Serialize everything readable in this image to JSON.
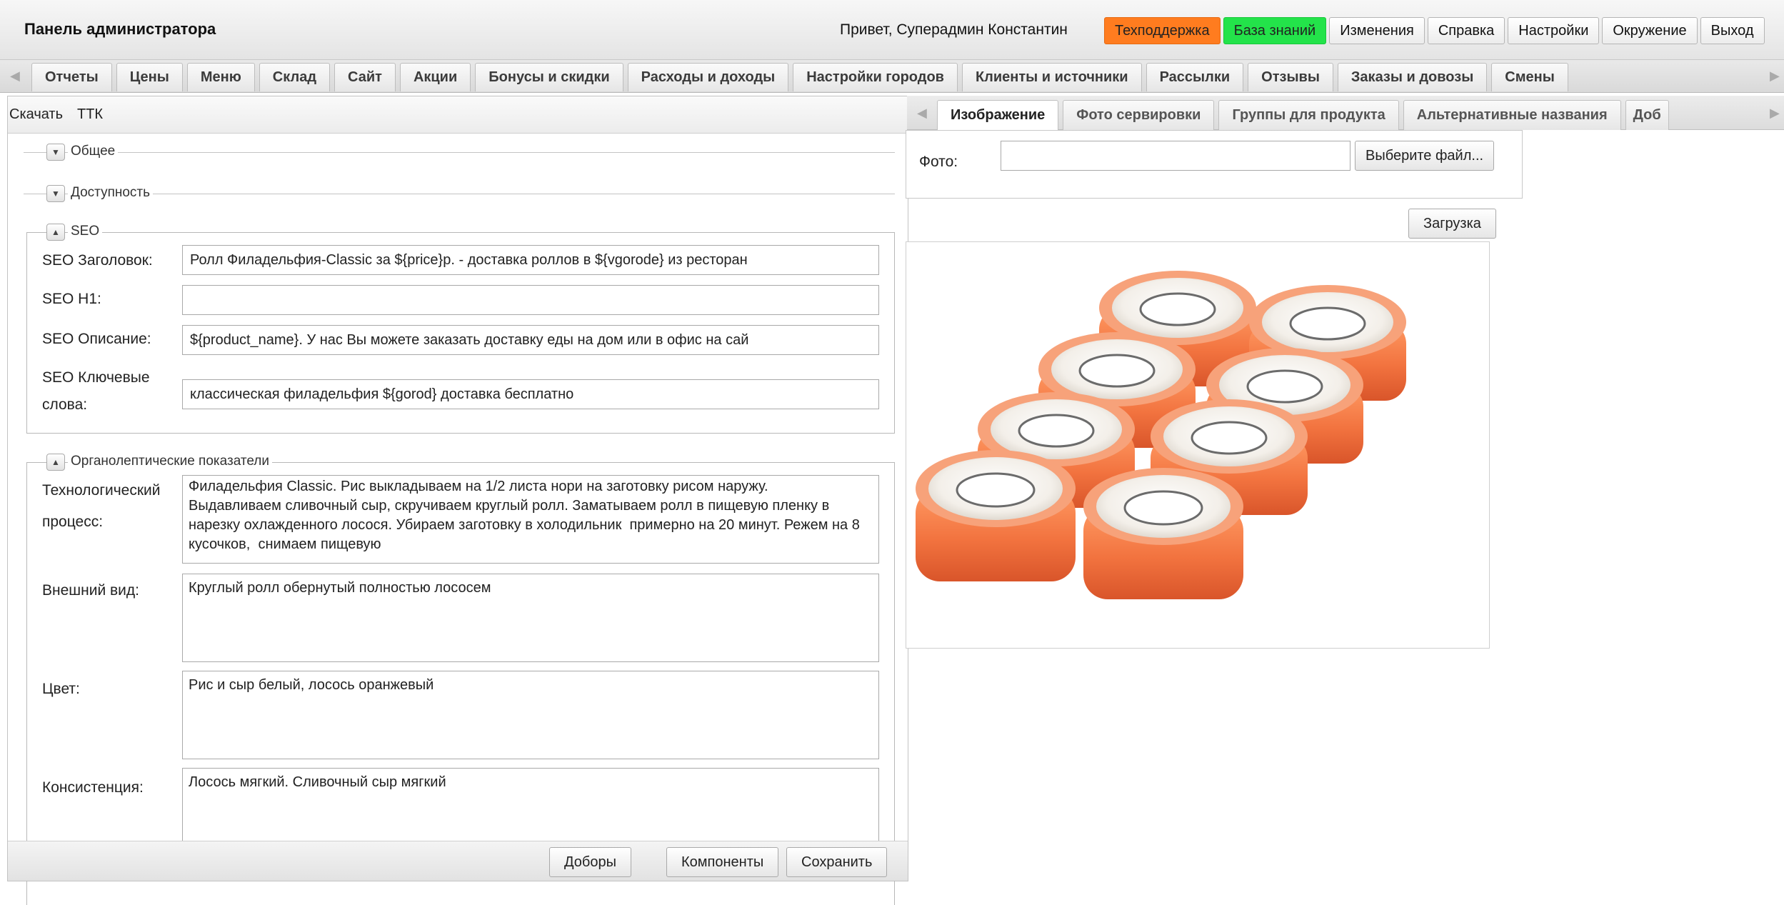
{
  "header": {
    "brand": "Панель администратора",
    "greeting": "Привет, Суперадмин Константин",
    "links": [
      {
        "label": "Техподдержка",
        "color": "#ff7c1f"
      },
      {
        "label": "База знаний",
        "color": "#23e34a"
      },
      {
        "label": "Изменения"
      },
      {
        "label": "Справка"
      },
      {
        "label": "Настройки"
      },
      {
        "label": "Окружение"
      },
      {
        "label": "Выход"
      }
    ]
  },
  "main_tabs": [
    "Отчеты",
    "Цены",
    "Меню",
    "Склад",
    "Сайт",
    "Акции",
    "Бонусы и скидки",
    "Расходы и доходы",
    "Настройки городов",
    "Клиенты и источники",
    "Рассылки",
    "Отзывы",
    "Заказы и довозы",
    "Смены"
  ],
  "left": {
    "toolbar": {
      "download": "Скачать",
      "ttk": "ТТК"
    },
    "sections": {
      "general": "Общее",
      "availability": "Доступность",
      "seo": "SEO",
      "organoleptic": "Органолептические показатели"
    },
    "seo": {
      "title_label": "SEO Заголовок:",
      "title_value": "Ролл Филадельфия-Classic за ${price}р. - доставка роллов в ${vgorode} из ресторан",
      "h1_label": "SEO H1:",
      "h1_value": "",
      "desc_label": "SEO Описание:",
      "desc_value": "${product_name}. У нас Вы можете заказать доставку еды на дом или в офис на сай",
      "keywords_label_1": "SEO Ключевые",
      "keywords_label_2": "слова:",
      "keywords_value": "классическая филадельфия ${gorod} доставка бесплатно"
    },
    "organo": {
      "process_label_1": "Технологический",
      "process_label_2": "процесс:",
      "process_value": "Филадельфия Classic. Рис выкладываем на 1/2 листа нори на заготовку рисом наружу.   Выдавливаем сливочный сыр, скручиваем круглый ролл. Заматываем ролл в пищевую пленку в нарезку охлажденного лосося. Убираем заготовку в холодильник  примерно на 20 минут. Режем на 8 кусочков,  снимаем пищевую",
      "look_label": "Внешний вид:",
      "look_value": "Круглый ролл обернутый полностью лососем",
      "color_label": "Цвет:",
      "color_value": "Рис и сыр белый, лосось оранжевый",
      "consistency_label": "Консистенция:",
      "consistency_value": "Лосось мягкий. Сливочный сыр мягкий"
    },
    "footer": {
      "additions": "Доборы",
      "components": "Компоненты",
      "save": "Сохранить"
    }
  },
  "right": {
    "tabs": [
      "Изображение",
      "Фото сервировки",
      "Группы для продукта",
      "Альтернативные названия",
      "Доб"
    ],
    "photo_label": "Фото:",
    "photo_value": "",
    "choose_file": "Выберите файл...",
    "upload": "Загрузка"
  },
  "colors": {
    "salmon": "#f2733f",
    "rice": "#f4f1ec",
    "accent_orange": "#ff7c1f",
    "accent_green": "#23e34a"
  }
}
